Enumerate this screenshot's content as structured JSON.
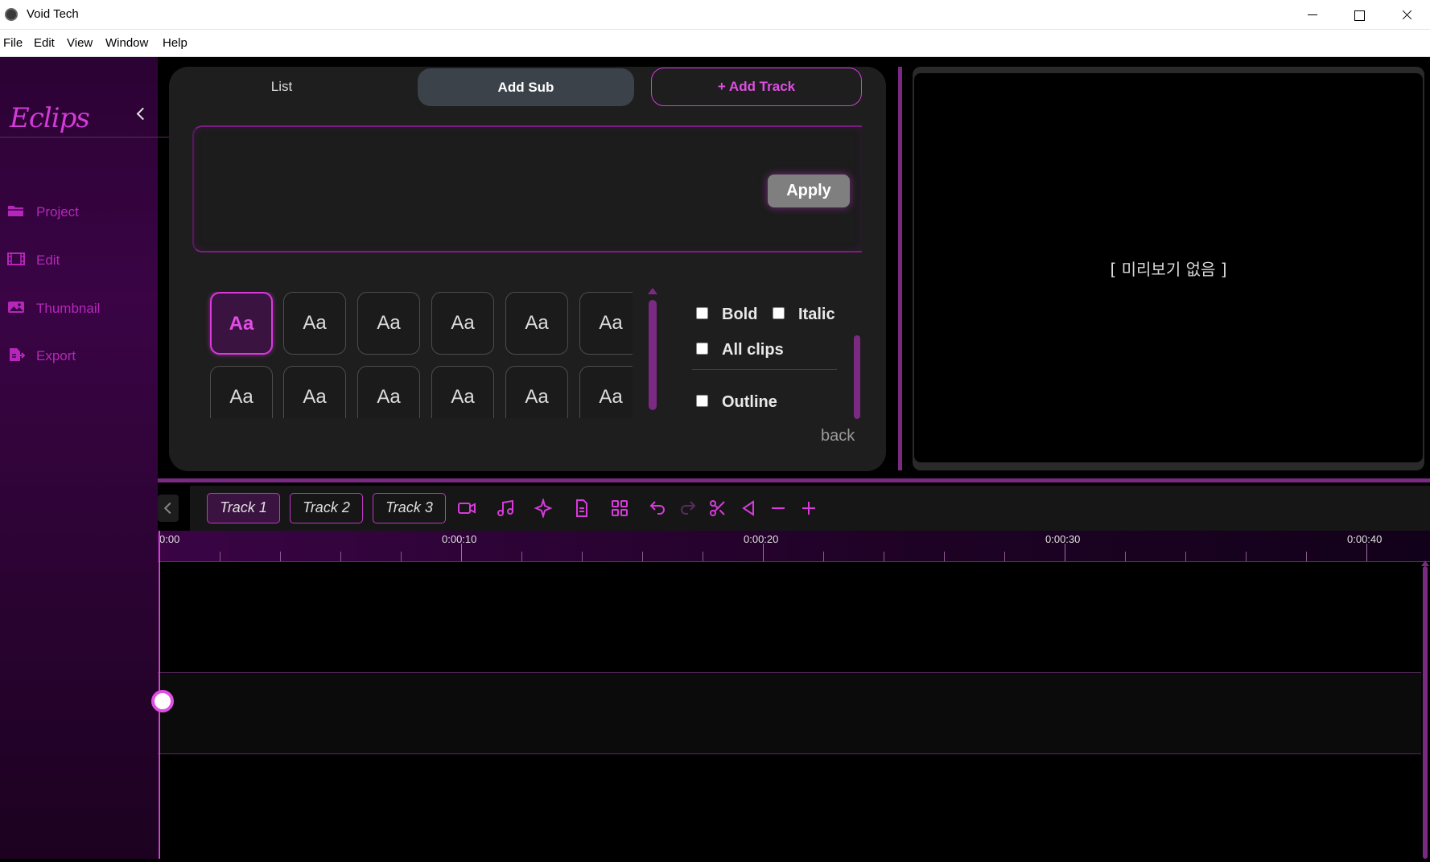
{
  "window": {
    "title": "Void Tech"
  },
  "menu": [
    "File",
    "Edit",
    "Window",
    "Help"
  ],
  "menu_view": "View",
  "sidebar": {
    "brand": "Eclips",
    "items": [
      {
        "label": "Project",
        "icon": "folder-icon"
      },
      {
        "label": "Edit",
        "icon": "film-icon"
      },
      {
        "label": "Thumbnail",
        "icon": "image-icon"
      },
      {
        "label": "Export",
        "icon": "export-icon"
      }
    ]
  },
  "panel": {
    "tabs": {
      "list": "List",
      "add_sub": "Add Sub"
    },
    "add_track": "+ Add Track",
    "apply": "Apply",
    "style_sample": "Aa",
    "options": {
      "bold": "Bold",
      "italic": "Italic",
      "all_clips": "All clips",
      "outline": "Outline"
    },
    "back": "back"
  },
  "preview": {
    "empty_text": "[ 미리보기 없음 ]"
  },
  "timeline": {
    "tracks": [
      "Track 1",
      "Track 2",
      "Track 3"
    ],
    "active_track": "Track 1",
    "ruler_labels": [
      "0:00",
      "0:00:10",
      "0:00:20",
      "0:00:30",
      "0:00:40"
    ],
    "tools": [
      "video-icon",
      "music-icon",
      "sparkle-icon",
      "document-icon",
      "grid-icon",
      "undo-icon",
      "redo-icon",
      "scissors-icon",
      "trim-icon",
      "zoom-out-icon",
      "zoom-in-icon"
    ]
  },
  "colors": {
    "accent": "#d83adc",
    "sidebar_bg": "#2b0233",
    "panel_bg": "#1e1e1e"
  }
}
